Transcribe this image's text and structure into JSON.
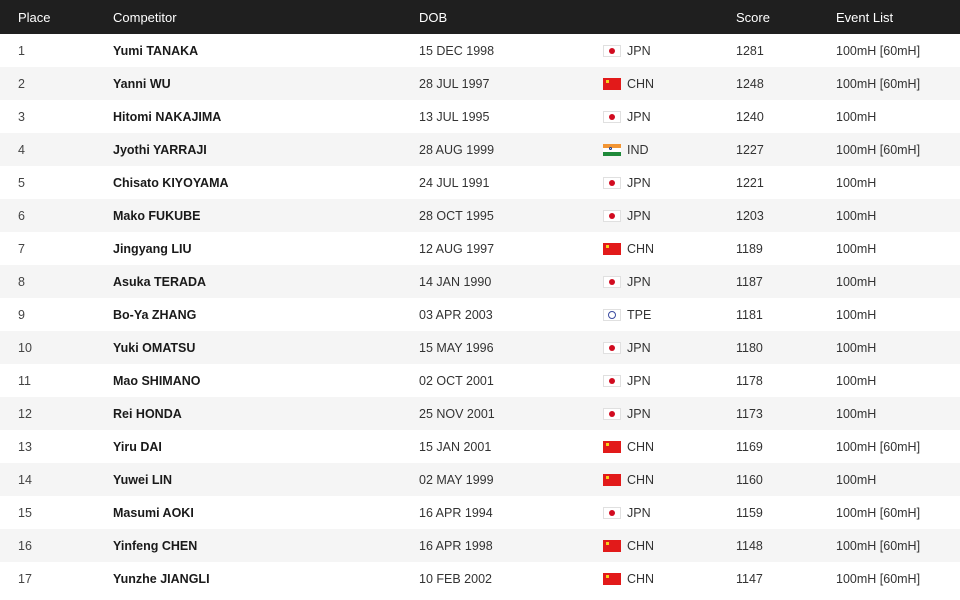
{
  "header": {
    "place": "Place",
    "competitor": "Competitor",
    "dob": "DOB",
    "score": "Score",
    "events": "Event List"
  },
  "rows": [
    {
      "place": "1",
      "name": "Yumi TANAKA",
      "dob": "15 DEC 1998",
      "country": "JPN",
      "flag_icon": "japan-flag-icon",
      "score": "1281",
      "events": "100mH [60mH]"
    },
    {
      "place": "2",
      "name": "Yanni WU",
      "dob": "28 JUL 1997",
      "country": "CHN",
      "flag_icon": "china-flag-icon",
      "score": "1248",
      "events": "100mH [60mH]"
    },
    {
      "place": "3",
      "name": "Hitomi NAKAJIMA",
      "dob": "13 JUL 1995",
      "country": "JPN",
      "flag_icon": "japan-flag-icon",
      "score": "1240",
      "events": "100mH"
    },
    {
      "place": "4",
      "name": "Jyothi YARRAJI",
      "dob": "28 AUG 1999",
      "country": "IND",
      "flag_icon": "india-flag-icon",
      "score": "1227",
      "events": "100mH [60mH]"
    },
    {
      "place": "5",
      "name": "Chisato KIYOYAMA",
      "dob": "24 JUL 1991",
      "country": "JPN",
      "flag_icon": "japan-flag-icon",
      "score": "1221",
      "events": "100mH"
    },
    {
      "place": "6",
      "name": "Mako FUKUBE",
      "dob": "28 OCT 1995",
      "country": "JPN",
      "flag_icon": "japan-flag-icon",
      "score": "1203",
      "events": "100mH"
    },
    {
      "place": "7",
      "name": "Jingyang LIU",
      "dob": "12 AUG 1997",
      "country": "CHN",
      "flag_icon": "china-flag-icon",
      "score": "1189",
      "events": "100mH"
    },
    {
      "place": "8",
      "name": "Asuka TERADA",
      "dob": "14 JAN 1990",
      "country": "JPN",
      "flag_icon": "japan-flag-icon",
      "score": "1187",
      "events": "100mH"
    },
    {
      "place": "9",
      "name": "Bo-Ya ZHANG",
      "dob": "03 APR 2003",
      "country": "TPE",
      "flag_icon": "chinese-taipei-flag-icon",
      "score": "1181",
      "events": "100mH"
    },
    {
      "place": "10",
      "name": "Yuki OMATSU",
      "dob": "15 MAY 1996",
      "country": "JPN",
      "flag_icon": "japan-flag-icon",
      "score": "1180",
      "events": "100mH"
    },
    {
      "place": "11",
      "name": "Mao SHIMANO",
      "dob": "02 OCT 2001",
      "country": "JPN",
      "flag_icon": "japan-flag-icon",
      "score": "1178",
      "events": "100mH"
    },
    {
      "place": "12",
      "name": "Rei HONDA",
      "dob": "25 NOV 2001",
      "country": "JPN",
      "flag_icon": "japan-flag-icon",
      "score": "1173",
      "events": "100mH"
    },
    {
      "place": "13",
      "name": "Yiru DAI",
      "dob": "15 JAN 2001",
      "country": "CHN",
      "flag_icon": "china-flag-icon",
      "score": "1169",
      "events": "100mH [60mH]"
    },
    {
      "place": "14",
      "name": "Yuwei LIN",
      "dob": "02 MAY 1999",
      "country": "CHN",
      "flag_icon": "china-flag-icon",
      "score": "1160",
      "events": "100mH"
    },
    {
      "place": "15",
      "name": "Masumi AOKI",
      "dob": "16 APR 1994",
      "country": "JPN",
      "flag_icon": "japan-flag-icon",
      "score": "1159",
      "events": "100mH [60mH]"
    },
    {
      "place": "16",
      "name": "Yinfeng CHEN",
      "dob": "16 APR 1998",
      "country": "CHN",
      "flag_icon": "china-flag-icon",
      "score": "1148",
      "events": "100mH [60mH]"
    },
    {
      "place": "17",
      "name": "Yunzhe JIANGLI",
      "dob": "10 FEB 2002",
      "country": "CHN",
      "flag_icon": "china-flag-icon",
      "score": "1147",
      "events": "100mH [60mH]"
    }
  ],
  "colors": {
    "header_bg": "#1f1f1f",
    "header_text": "#ffffff",
    "row_alt_bg": "#f5f5f5"
  }
}
